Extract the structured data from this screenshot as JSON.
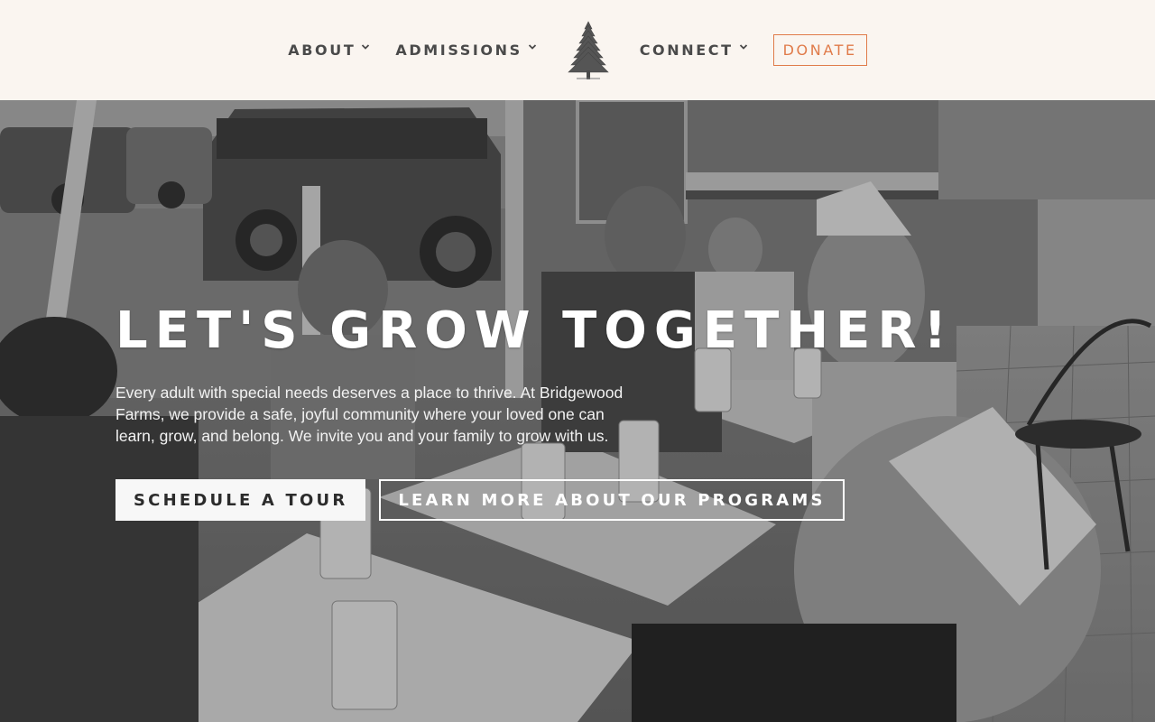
{
  "header": {
    "nav": {
      "about": "ABOUT",
      "admissions": "ADMISSIONS",
      "connect": "CONNECT"
    },
    "logo_icon": "pine-tree-icon",
    "donate_label": "DONATE",
    "accent_color": "#e07b4a"
  },
  "hero": {
    "title": "LET'S GROW TOGETHER!",
    "description": "Every adult with special needs deserves a place to thrive. At Bridgewood Farms, we provide a safe, joyful community where your loved one can learn, grow, and belong. We invite you and your family to grow with us.",
    "primary_button": "SCHEDULE A TOUR",
    "secondary_button": "LEARN MORE ABOUT OUR PROGRAMS"
  }
}
